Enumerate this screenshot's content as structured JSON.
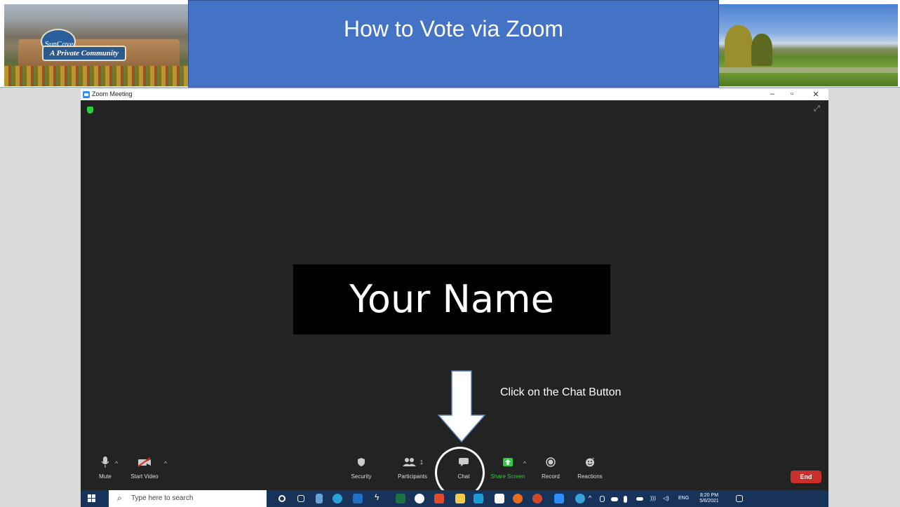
{
  "slide": {
    "title": "How to Vote via Zoom",
    "sign_line1": "SunCove",
    "sign_line2": "A Private Community"
  },
  "zoom": {
    "window_title": "Zoom Meeting",
    "participant_name": "Your Name",
    "annotation": "Click on the Chat Button",
    "participants_count": "1",
    "toolbar": {
      "mute": "Mute",
      "start_video": "Start Video",
      "security": "Security",
      "participants": "Participants",
      "chat": "Chat",
      "share_screen": "Share Screen",
      "record": "Record",
      "reactions": "Reactions",
      "end": "End"
    }
  },
  "taskbar": {
    "search_placeholder": "Type here to search",
    "language": "ENG",
    "time": "8:20 PM",
    "date": "5/6/2021"
  },
  "colors": {
    "title_bg": "#4472c4",
    "zoom_bg": "#232323",
    "share_green": "#2ecc40",
    "end_red": "#c9302c",
    "taskbar": "#18335a"
  }
}
